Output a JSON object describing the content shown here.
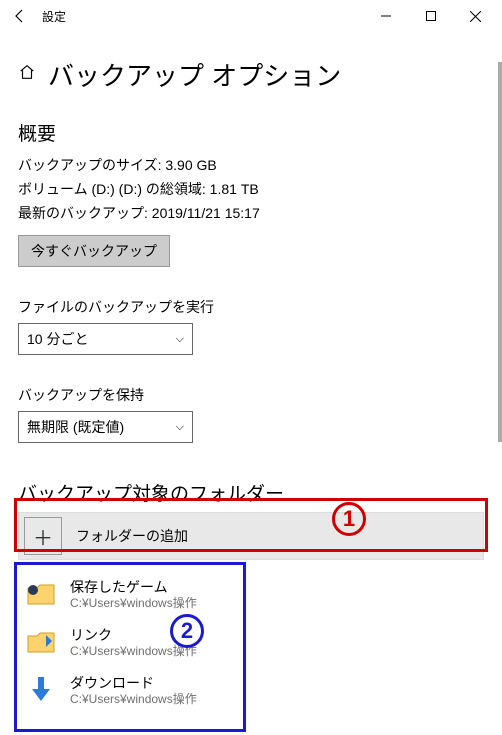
{
  "titlebar": {
    "title": "設定"
  },
  "header": {
    "page_title": "バックアップ オプション"
  },
  "overview": {
    "heading": "概要",
    "size_line": "バックアップのサイズ: 3.90 GB",
    "volume_line": "ボリューム (D:) (D:) の総領域: 1.81 TB",
    "last_line": "最新のバックアップ: 2019/11/21 15:17",
    "backup_now": "今すぐバックアップ"
  },
  "frequency": {
    "label": "ファイルのバックアップを実行",
    "value": "10 分ごと"
  },
  "retention": {
    "label": "バックアップを保持",
    "value": "無期限 (既定値)"
  },
  "folders": {
    "heading": "バックアップ対象のフォルダー",
    "add_label": "フォルダーの追加",
    "items": [
      {
        "name": "保存したゲーム",
        "path": "C:¥Users¥windows操作"
      },
      {
        "name": "リンク",
        "path": "C:¥Users¥windows操作"
      },
      {
        "name": "ダウンロード",
        "path": "C:¥Users¥windows操作"
      }
    ]
  },
  "annotations": {
    "one": "1",
    "two": "2"
  }
}
